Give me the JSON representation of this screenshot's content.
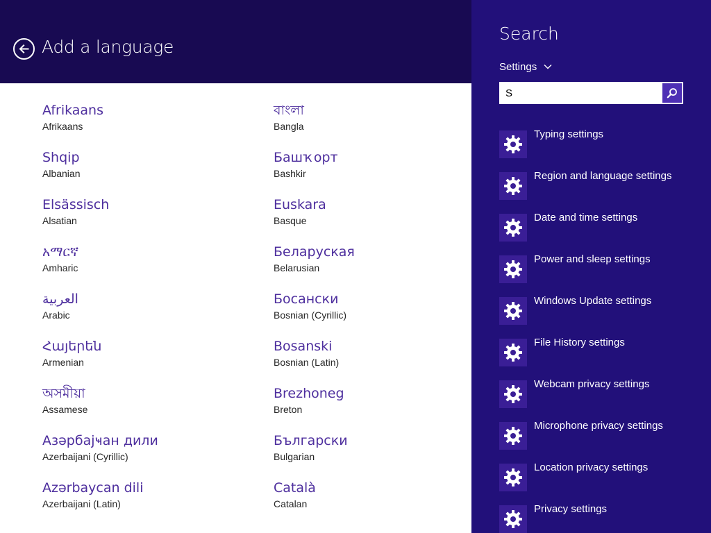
{
  "header": {
    "title": "Add a language",
    "back_icon": "back-arrow-icon"
  },
  "languages": [
    {
      "native": "Afrikaans",
      "english": "Afrikaans"
    },
    {
      "native": "Shqip",
      "english": "Albanian"
    },
    {
      "native": "Elsässisch",
      "english": "Alsatian"
    },
    {
      "native": "አማርኛ",
      "english": "Amharic"
    },
    {
      "native": "العربية",
      "english": "Arabic"
    },
    {
      "native": "Հայերեն",
      "english": "Armenian"
    },
    {
      "native": "অসমীয়া",
      "english": "Assamese"
    },
    {
      "native": "Азәрбајҹан дили",
      "english": "Azerbaijani (Cyrillic)"
    },
    {
      "native": "Azərbaycan dili",
      "english": "Azerbaijani (Latin)"
    },
    {
      "native": "বাংলা",
      "english": "Bangla"
    },
    {
      "native": "Башҡорт",
      "english": "Bashkir"
    },
    {
      "native": "Euskara",
      "english": "Basque"
    },
    {
      "native": "Беларуская",
      "english": "Belarusian"
    },
    {
      "native": "Босански",
      "english": "Bosnian (Cyrillic)"
    },
    {
      "native": "Bosanski",
      "english": "Bosnian (Latin)"
    },
    {
      "native": "Brezhoneg",
      "english": "Breton"
    },
    {
      "native": "Български",
      "english": "Bulgarian"
    },
    {
      "native": "Català",
      "english": "Catalan"
    }
  ],
  "search": {
    "title": "Search",
    "scope": "Settings",
    "query": "S",
    "search_icon": "search-icon",
    "results": [
      {
        "label": "Typing settings",
        "icon": "gear-icon"
      },
      {
        "label": "Region and language settings",
        "icon": "gear-icon"
      },
      {
        "label": "Date and time settings",
        "icon": "gear-icon"
      },
      {
        "label": "Power and sleep settings",
        "icon": "gear-icon"
      },
      {
        "label": "Windows Update settings",
        "icon": "gear-icon"
      },
      {
        "label": "File History settings",
        "icon": "gear-icon"
      },
      {
        "label": "Webcam privacy settings",
        "icon": "gear-icon"
      },
      {
        "label": "Microphone privacy settings",
        "icon": "gear-icon"
      },
      {
        "label": "Location privacy settings",
        "icon": "gear-icon"
      },
      {
        "label": "Privacy settings",
        "icon": "gear-icon"
      }
    ]
  },
  "colors": {
    "header_bg": "#180a52",
    "charm_bg": "#22107a",
    "accent_text": "#4e2f9e",
    "search_button": "#4e2fb5"
  }
}
